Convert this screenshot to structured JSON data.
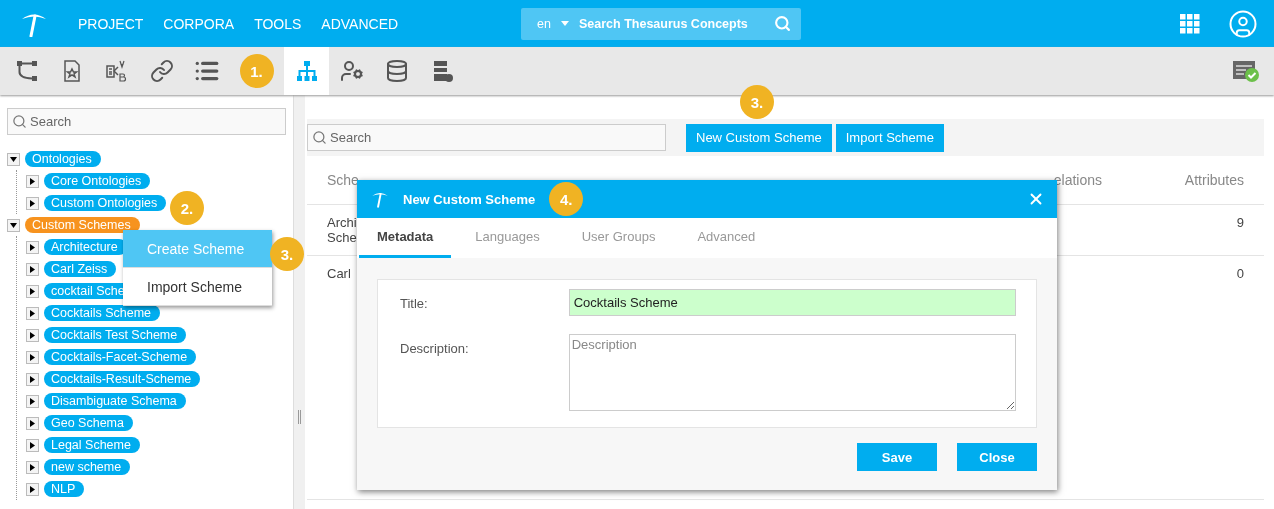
{
  "header": {
    "nav": [
      "PROJECT",
      "CORPORA",
      "TOOLS",
      "ADVANCED"
    ],
    "search": {
      "language": "en",
      "placeholder": "Search Thesaurus Concepts"
    }
  },
  "toolbar": {
    "tools": [
      {
        "kind": "tree",
        "selected": false
      },
      {
        "kind": "star-doc",
        "selected": false
      },
      {
        "kind": "compare",
        "selected": false
      },
      {
        "kind": "link",
        "selected": false
      },
      {
        "kind": "list",
        "selected": false
      },
      {
        "kind": "step",
        "label": "1.",
        "selected": false
      },
      {
        "kind": "hierarchy",
        "selected": true
      },
      {
        "kind": "user-gear",
        "selected": false
      },
      {
        "kind": "database",
        "selected": false
      },
      {
        "kind": "server",
        "selected": false
      }
    ]
  },
  "sidebar": {
    "search": {
      "placeholder": "Search"
    },
    "tree": [
      {
        "label": "Ontologies",
        "expanded": true,
        "selected": false,
        "children": [
          {
            "label": "Core Ontologies",
            "expanded": false,
            "selected": false
          },
          {
            "label": "Custom Ontologies",
            "expanded": false,
            "selected": false
          }
        ]
      },
      {
        "label": "Custom Schemes",
        "expanded": true,
        "selected": true,
        "children": [
          {
            "label": "Architecture",
            "expanded": false,
            "selected": false
          },
          {
            "label": "Carl Zeiss",
            "expanded": false,
            "selected": false
          },
          {
            "label": "cocktail Sche",
            "expanded": false,
            "selected": false
          },
          {
            "label": "Cocktails Scheme",
            "expanded": false,
            "selected": false
          },
          {
            "label": "Cocktails Test Scheme",
            "expanded": false,
            "selected": false
          },
          {
            "label": "Cocktails-Facet-Scheme",
            "expanded": false,
            "selected": false
          },
          {
            "label": "Cocktails-Result-Scheme",
            "expanded": false,
            "selected": false
          },
          {
            "label": "Disambiguate Schema",
            "expanded": false,
            "selected": false
          },
          {
            "label": "Geo Schema",
            "expanded": false,
            "selected": false
          },
          {
            "label": "Legal Scheme",
            "expanded": false,
            "selected": false
          },
          {
            "label": "new scheme",
            "expanded": false,
            "selected": false
          },
          {
            "label": "NLP",
            "expanded": false,
            "selected": false
          }
        ]
      }
    ],
    "step_badge": "2."
  },
  "context_menu": {
    "items": [
      {
        "label": "Create Scheme",
        "selected": true
      },
      {
        "label": "Import Scheme",
        "selected": false
      }
    ],
    "step_badge": "3."
  },
  "main": {
    "search": {
      "placeholder": "Search"
    },
    "buttons": [
      "New Custom Scheme",
      "Import Scheme"
    ],
    "step_badge": "3.",
    "table": {
      "columns": [
        "Sche",
        "elations",
        "Attributes"
      ],
      "rows": [
        {
          "cells": [
            [
              "Archi",
              "Sche"
            ],
            [],
            [
              "9"
            ]
          ]
        },
        {
          "cells": [
            [
              "Carl"
            ],
            [],
            [
              "0"
            ]
          ]
        }
      ]
    }
  },
  "dialog": {
    "title": "New Custom Scheme",
    "step_badge": "4.",
    "tabs": [
      {
        "label": "Metadata",
        "selected": true
      },
      {
        "label": "Languages",
        "selected": false
      },
      {
        "label": "User Groups",
        "selected": false
      },
      {
        "label": "Advanced",
        "selected": false
      }
    ],
    "fields": [
      {
        "label": "Title:",
        "kind": "text",
        "value": "Cocktails Scheme",
        "valid": true
      },
      {
        "label": "Description:",
        "kind": "textarea",
        "placeholder": "Description"
      }
    ],
    "buttons": [
      "Save",
      "Close"
    ]
  }
}
